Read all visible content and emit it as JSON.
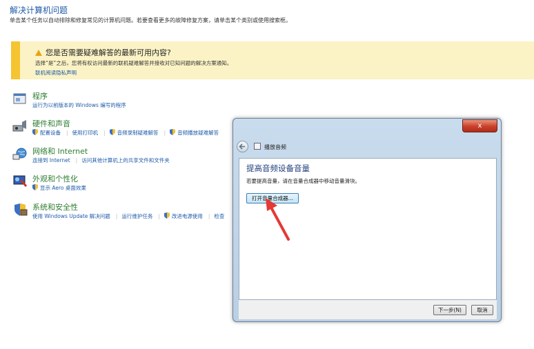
{
  "page": {
    "title": "解决计算机问题",
    "description": "单击某个任务以自动排除和修复常见的计算机问题。若要查看更多的故障修复方案，请单击某个类别或使用搜索框。"
  },
  "notice": {
    "heading": "您是否需要疑难解答的最新可用内容?",
    "text": "选择“是”之后，您将有权访问最新的联机疑难解答并接收对已知问题的解决方案通知。",
    "link": "联机阅读隐私声明"
  },
  "categories": [
    {
      "title": "程序",
      "icon": "programs-icon",
      "links": [
        "运行为以前版本的 Windows 编写的程序"
      ]
    },
    {
      "title": "硬件和声音",
      "icon": "hardware-sound-icon",
      "links": [
        "配置设备",
        "使用打印机",
        "音频录制疑难解答",
        "音频播放疑难解答"
      ]
    },
    {
      "title": "网络和 Internet",
      "icon": "network-icon",
      "links": [
        "连接到 Internet",
        "访问其他计算机上的共享文件和文件夹"
      ]
    },
    {
      "title": "外观和个性化",
      "icon": "appearance-icon",
      "links": [
        "显示 Aero 桌面效果"
      ]
    },
    {
      "title": "系统和安全性",
      "icon": "system-security-icon",
      "links": [
        "使用 Windows Update 解决问题",
        "运行维护任务",
        "改进电源使用",
        "检查"
      ]
    }
  ],
  "dialog": {
    "close_label": "x",
    "wizard_title": "播放音频",
    "heading": "提高音频设备音量",
    "text": "若要提高音量，请在音量合成器中移动音量滑块。",
    "open_mixer_button": "打开音量合成器...",
    "next_button": "下一步(N)",
    "cancel_button": "取消"
  },
  "colors": {
    "link": "#1e5aa8",
    "category_title": "#2e7d32",
    "notice_bg": "#fbf3c5",
    "notice_bar": "#f5c431",
    "annotation_arrow": "#e53935"
  }
}
